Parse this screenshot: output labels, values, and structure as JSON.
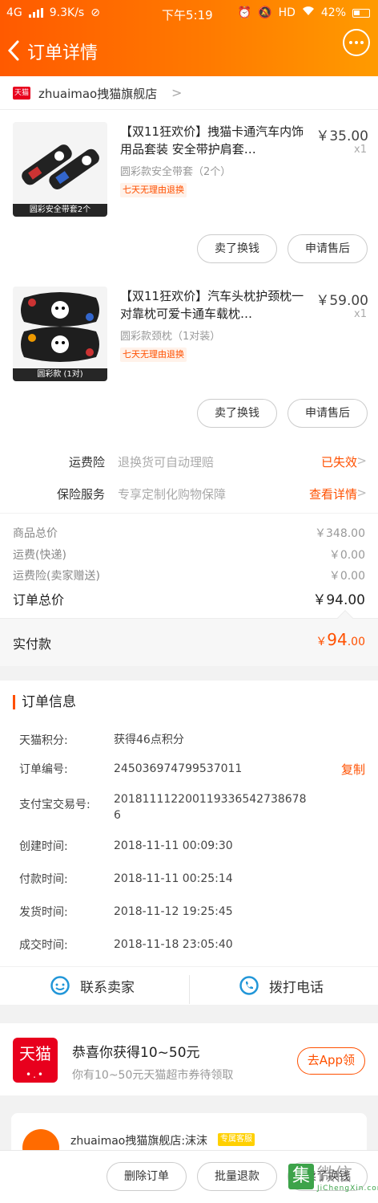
{
  "status_bar": {
    "network": "4G",
    "speed": "9.3K/s",
    "time": "下午5:19",
    "hd": "HD",
    "battery": "42%"
  },
  "header": {
    "title": "订单详情"
  },
  "shop": {
    "badge": "天猫",
    "name": "zhuaimao拽猫旗舰店"
  },
  "items": [
    {
      "title": "【双11狂欢价】拽猫卡通汽车内饰用品套装 安全带护肩套…",
      "sku": "圆彩款安全带套（2个）",
      "tag": "七天无理由退换",
      "price": "￥35.00",
      "qty": "x1",
      "thumb_caption": "圆彩安全带套2个",
      "sell_label": "卖了换钱",
      "aftersale_label": "申请售后"
    },
    {
      "title": "【双11狂欢价】汽车头枕护颈枕一对靠枕可爱卡通车载枕…",
      "sku": "圆彩款颈枕（1对装）",
      "tag": "七天无理由退换",
      "price": "￥59.00",
      "qty": "x1",
      "thumb_caption": "圆彩款 (1对)",
      "sell_label": "卖了换钱",
      "aftersale_label": "申请售后"
    }
  ],
  "services": [
    {
      "label": "运费险",
      "desc": "退换货可自动理赔",
      "link": "已失效"
    },
    {
      "label": "保险服务",
      "desc": "专享定制化购物保障",
      "link": "查看详情"
    }
  ],
  "totals": {
    "goods_label": "商品总价",
    "goods_value": "￥348.00",
    "shipping_label": "运费(快递)",
    "shipping_value": "￥0.00",
    "insurance_label": "运费险(卖家赠送)",
    "insurance_value": "￥0.00",
    "order_total_label": "订单总价",
    "order_total_value": "￥94.00"
  },
  "paid": {
    "label": "实付款",
    "yen": "￥",
    "integer": "94",
    "decimal": ".00"
  },
  "order_info": {
    "title": "订单信息",
    "rows": [
      {
        "label": "天猫积分:",
        "value": "获得46点积分"
      },
      {
        "label": "订单编号:",
        "value": "245036974799537011",
        "action": "复制"
      },
      {
        "label": "支付宝交易号:",
        "value": "2018111122001193365427386786"
      },
      {
        "label": "创建时间:",
        "value": "2018-11-11 00:09:30"
      },
      {
        "label": "付款时间:",
        "value": "2018-11-11 00:25:14"
      },
      {
        "label": "发货时间:",
        "value": "2018-11-12 19:25:45"
      },
      {
        "label": "成交时间:",
        "value": "2018-11-18 23:05:40"
      }
    ],
    "contact_seller": "联系卖家",
    "call_phone": "拨打电话"
  },
  "promo": {
    "logo_text": "天猫",
    "title": "恭喜你获得10~50元",
    "subtitle": "你有10~50元天猫超市券待领取",
    "button": "去App领"
  },
  "chat": {
    "name": "zhuaimao拽猫旗舰店:沫沫",
    "tag": "专属客服"
  },
  "bottom_bar": {
    "delete": "删除订单",
    "batch_refund": "批量退款",
    "sell": "卖了换钱"
  },
  "watermark": {
    "icon_char": "集",
    "text": "微信",
    "url": "JiChengXin.com"
  },
  "colors": {
    "brand_orange": "#ff5000",
    "header_gradient_start": "#ff5a00",
    "header_gradient_end": "#ff9b00",
    "tmall_red": "#e8001d"
  }
}
